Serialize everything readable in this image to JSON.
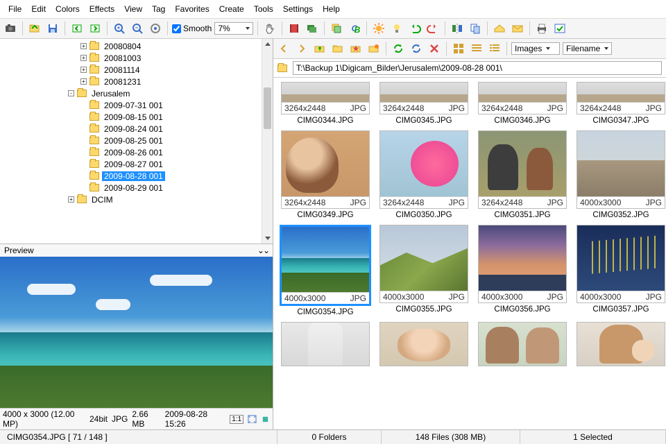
{
  "menu": [
    "File",
    "Edit",
    "Colors",
    "Effects",
    "View",
    "Tag",
    "Favorites",
    "Create",
    "Tools",
    "Settings",
    "Help"
  ],
  "toolbar1": {
    "smooth": "Smooth",
    "zoom": "7%"
  },
  "tree": {
    "items": [
      {
        "level": 2,
        "exp": "+",
        "label": "20080804"
      },
      {
        "level": 2,
        "exp": "+",
        "label": "20081003"
      },
      {
        "level": 2,
        "exp": "+",
        "label": "20081114"
      },
      {
        "level": 2,
        "exp": "+",
        "label": "20081231"
      },
      {
        "level": 1,
        "exp": "-",
        "label": "Jerusalem"
      },
      {
        "level": 2,
        "exp": "",
        "label": "2009-07-31 001"
      },
      {
        "level": 2,
        "exp": "",
        "label": "2009-08-15 001"
      },
      {
        "level": 2,
        "exp": "",
        "label": "2009-08-24 001"
      },
      {
        "level": 2,
        "exp": "",
        "label": "2009-08-25 001"
      },
      {
        "level": 2,
        "exp": "",
        "label": "2009-08-26 001"
      },
      {
        "level": 2,
        "exp": "",
        "label": "2009-08-27 001"
      },
      {
        "level": 2,
        "exp": "",
        "label": "2009-08-28 001",
        "sel": true
      },
      {
        "level": 2,
        "exp": "",
        "label": "2009-08-29 001"
      },
      {
        "level": 1,
        "exp": "+",
        "label": "DCIM"
      }
    ]
  },
  "preview": {
    "title": "Preview",
    "dims": "4000 x 3000 (12.00 MP)",
    "depth": "24bit",
    "fmt": "JPG",
    "size": "2.66 MB",
    "date": "2009-08-28 15:26",
    "ratio": "1:1"
  },
  "path": "T:\\Backup 1\\Digicam_Bilder\\Jerusalem\\2009-08-28 001\\",
  "dropdown_view": "Images",
  "dropdown_sort": "Filename",
  "thumbs": [
    {
      "scene": "sc-wall",
      "dims": "3264x2448",
      "fmt": "JPG",
      "name": "CIMG0344.JPG",
      "short": true
    },
    {
      "scene": "sc-wall",
      "dims": "3264x2448",
      "fmt": "JPG",
      "name": "CIMG0345.JPG",
      "short": true
    },
    {
      "scene": "sc-wall",
      "dims": "3264x2448",
      "fmt": "JPG",
      "name": "CIMG0346.JPG",
      "short": true
    },
    {
      "scene": "sc-wall",
      "dims": "3264x2448",
      "fmt": "JPG",
      "name": "CIMG0347.JPG",
      "short": true
    },
    {
      "scene": "sc-girl",
      "dims": "3264x2448",
      "fmt": "JPG",
      "name": "CIMG0349.JPG"
    },
    {
      "scene": "sc-flamingo",
      "dims": "3264x2448",
      "fmt": "JPG",
      "name": "CIMG0350.JPG"
    },
    {
      "scene": "sc-family",
      "dims": "3264x2448",
      "fmt": "JPG",
      "name": "CIMG0351.JPG"
    },
    {
      "scene": "sc-city",
      "dims": "4000x3000",
      "fmt": "JPG",
      "name": "CIMG0352.JPG"
    },
    {
      "scene": "sc-ocean",
      "dims": "4000x3000",
      "fmt": "JPG",
      "name": "CIMG0354.JPG",
      "sel": true
    },
    {
      "scene": "sc-hills",
      "dims": "4000x3000",
      "fmt": "JPG",
      "name": "CIMG0355.JPG"
    },
    {
      "scene": "sc-sunset",
      "dims": "4000x3000",
      "fmt": "JPG",
      "name": "CIMG0356.JPG"
    },
    {
      "scene": "sc-night",
      "dims": "4000x3000",
      "fmt": "JPG",
      "name": "CIMG0357.JPG"
    },
    {
      "scene": "sc-man",
      "name": "",
      "bottom": true
    },
    {
      "scene": "sc-baby",
      "name": "",
      "bottom": true
    },
    {
      "scene": "sc-couple",
      "name": "",
      "bottom": true
    },
    {
      "scene": "sc-mom",
      "name": "",
      "bottom": true
    }
  ],
  "status": {
    "current": "CIMG0354.JPG [ 71 / 148 ]",
    "folders": "0 Folders",
    "files": "148 Files (308 MB)",
    "selected": "1 Selected"
  }
}
